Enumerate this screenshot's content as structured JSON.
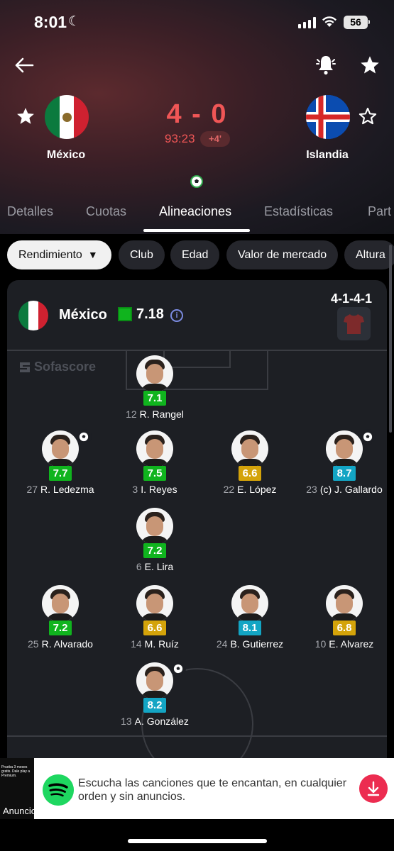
{
  "status": {
    "time": "8:01",
    "battery": "56"
  },
  "match": {
    "home": "México",
    "away": "Islandia",
    "score": "4 - 0",
    "time": "93:23",
    "added": "+4'"
  },
  "tabs": [
    {
      "label": "Detalles",
      "active": false
    },
    {
      "label": "Cuotas",
      "active": false
    },
    {
      "label": "Alineaciones",
      "active": true
    },
    {
      "label": "Estadísticas",
      "active": false
    },
    {
      "label": "Part",
      "active": false
    }
  ],
  "filters": [
    {
      "label": "Rendimiento",
      "selected": true
    },
    {
      "label": "Club",
      "selected": false
    },
    {
      "label": "Edad",
      "selected": false
    },
    {
      "label": "Valor de mercado",
      "selected": false
    },
    {
      "label": "Altura",
      "selected": false
    }
  ],
  "lineup": {
    "team": "México",
    "team_rating": "7.18",
    "formation": "4-1-4-1",
    "watermark": "Sofascore",
    "players": [
      {
        "num": "12",
        "name": "R. Rangel",
        "rating": "7.1",
        "tier": "green",
        "goal": false
      },
      {
        "num": "27",
        "name": "R. Ledezma",
        "rating": "7.7",
        "tier": "green",
        "goal": true
      },
      {
        "num": "3",
        "name": "I. Reyes",
        "rating": "7.5",
        "tier": "green",
        "goal": false
      },
      {
        "num": "22",
        "name": "E. López",
        "rating": "6.6",
        "tier": "yellow",
        "goal": false
      },
      {
        "num": "23",
        "name": "(c) J. Gallardo",
        "rating": "8.7",
        "tier": "blue",
        "goal": true
      },
      {
        "num": "6",
        "name": "E. Lira",
        "rating": "7.2",
        "tier": "green",
        "goal": false
      },
      {
        "num": "25",
        "name": "R. Alvarado",
        "rating": "7.2",
        "tier": "green",
        "goal": false
      },
      {
        "num": "14",
        "name": "M. Ruíz",
        "rating": "6.6",
        "tier": "yellow",
        "goal": false
      },
      {
        "num": "24",
        "name": "B. Gutierrez",
        "rating": "8.1",
        "tier": "blue",
        "goal": false
      },
      {
        "num": "10",
        "name": "E. Alvarez",
        "rating": "6.8",
        "tier": "yellow",
        "goal": false
      },
      {
        "num": "13",
        "name": "A. González",
        "rating": "8.2",
        "tier": "blue",
        "goal": true
      }
    ]
  },
  "ad": {
    "label": "Anuncios",
    "text": "Escucha las canciones que te encantan, en cualquier orden y sin anuncios.",
    "thumb_text": "Prueba 3 meses gratis. Dale play a Premium."
  },
  "colors": {
    "score_red": "#f05656",
    "rating_green": "#10b41e",
    "rating_yellow": "#d4a30a",
    "rating_blue": "#13a5c4",
    "spotify_green": "#1ed760",
    "download_red": "#ec2c50"
  },
  "icons": [
    "back-arrow-icon",
    "bell-icon",
    "star-icon",
    "star-outline-icon",
    "football-icon",
    "info-icon",
    "jersey-icon",
    "spotify-icon",
    "download-icon"
  ]
}
